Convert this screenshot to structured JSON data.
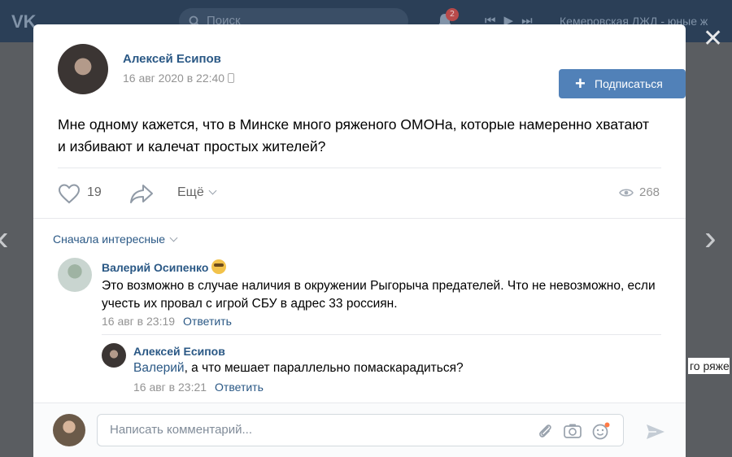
{
  "background": {
    "search_placeholder": "Поиск",
    "notification_count": "2",
    "player_track": "Кемеровская ЛЖД - юные ж",
    "peek_text": "го ряже"
  },
  "post": {
    "author": "Алексей Есипов",
    "date": "16 авг 2020 в 22:40",
    "subscribe_label": "Подписаться",
    "text": "Мне одному кажется, что в Минске много ряженого ОМОНа, которые намеренно хватают и избивают и калечат простых жителей?",
    "likes": "19",
    "more_label": "Ещё",
    "views": "268"
  },
  "comments_sort": "Сначала интересные",
  "comments": [
    {
      "author": "Валерий Осипенко",
      "text": "Это возможно в случае наличия в окружении Рыгорыча предателей. Что не невозможно, если учесть их провал с игрой СБУ в адрес 33 россиян.",
      "time": "16 авг в 23:19",
      "reply_label": "Ответить"
    },
    {
      "author": "Алексей Есипов",
      "mention": "Валерий",
      "text": ", а что мешает параллельно помаскарадиться?",
      "time": "16 авг в 23:21",
      "reply_label": "Ответить"
    }
  ],
  "composer": {
    "placeholder": "Написать комментарий..."
  },
  "colors": {
    "accent": "#5181b8",
    "link": "#2a5885",
    "muted": "#939393"
  },
  "icons": [
    "vk-logo-icon",
    "search-icon",
    "bell-icon",
    "play-icon",
    "close-icon",
    "heart-icon",
    "share-icon",
    "eye-icon",
    "attach-icon",
    "camera-icon",
    "emoji-icon",
    "send-icon"
  ]
}
